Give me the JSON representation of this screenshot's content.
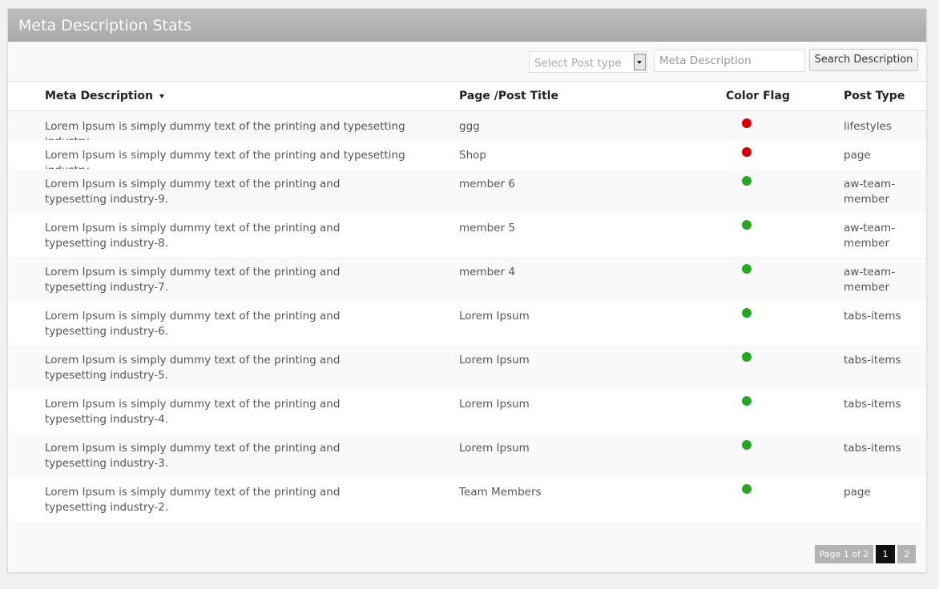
{
  "panel": {
    "title": "Meta Description Stats"
  },
  "toolbar": {
    "select_placeholder": "Select Post type",
    "search_placeholder": "Meta Description",
    "search_button": "Search Description"
  },
  "table": {
    "headers": {
      "description": "Meta Description",
      "title": "Page /Post Title",
      "flag": "Color Flag",
      "type": "Post Type"
    },
    "rows": [
      {
        "description": "Lorem Ipsum is simply dummy text of the printing and typesetting industry.",
        "title": "ggg",
        "flag": "red",
        "type": "lifestyles"
      },
      {
        "description": "Lorem Ipsum is simply dummy text of the printing and typesetting industry.",
        "title": "Shop",
        "flag": "red",
        "type": "page"
      },
      {
        "description": "Lorem Ipsum is simply dummy text of the printing and typesetting industry-9.",
        "title": "member 6",
        "flag": "green",
        "type": "aw-team-member"
      },
      {
        "description": "Lorem Ipsum is simply dummy text of the printing and typesetting industry-8.",
        "title": "member 5",
        "flag": "green",
        "type": "aw-team-member"
      },
      {
        "description": "Lorem Ipsum is simply dummy text of the printing and typesetting industry-7.",
        "title": "member 4",
        "flag": "green",
        "type": "aw-team-member"
      },
      {
        "description": "Lorem Ipsum is simply dummy text of the printing and typesetting industry-6.",
        "title": "Lorem Ipsum",
        "flag": "green",
        "type": "tabs-items"
      },
      {
        "description": "Lorem Ipsum is simply dummy text of the printing and typesetting industry-5.",
        "title": "Lorem Ipsum",
        "flag": "green",
        "type": "tabs-items"
      },
      {
        "description": "Lorem Ipsum is simply dummy text of the printing and typesetting industry-4.",
        "title": "Lorem Ipsum",
        "flag": "green",
        "type": "tabs-items"
      },
      {
        "description": "Lorem Ipsum is simply dummy text of the printing and typesetting industry-3.",
        "title": "Lorem Ipsum",
        "flag": "green",
        "type": "tabs-items"
      },
      {
        "description": "Lorem Ipsum is simply dummy text of the printing and typesetting industry-2.",
        "title": "Team Members",
        "flag": "green",
        "type": "page"
      }
    ]
  },
  "flag_colors": {
    "red": "#dd0000",
    "green": "#22aa22"
  },
  "pagination": {
    "info": "Page 1 of 2",
    "current": "1",
    "next": "2"
  }
}
